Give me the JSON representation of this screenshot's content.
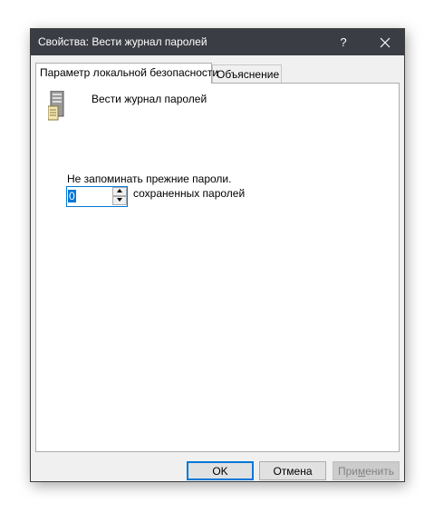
{
  "window": {
    "title": "Свойства: Вести журнал паролей",
    "help_label": "?",
    "close_label": "✕"
  },
  "tabs": [
    {
      "label": "Параметр локальной безопасности",
      "active": true
    },
    {
      "label": "Объяснение",
      "active": false
    }
  ],
  "policy": {
    "name": "Вести журнал паролей",
    "icon": "server-icon"
  },
  "setting": {
    "description": "Не запоминать прежние пароли.",
    "value": "0",
    "suffix": "сохраненных паролей"
  },
  "buttons": {
    "ok": "OK",
    "cancel": "Отмена",
    "apply_prefix": "При",
    "apply_mnemonic": "м",
    "apply_suffix": "енить"
  },
  "colors": {
    "titlebar": "#3b3d44",
    "accent": "#0078d7"
  }
}
